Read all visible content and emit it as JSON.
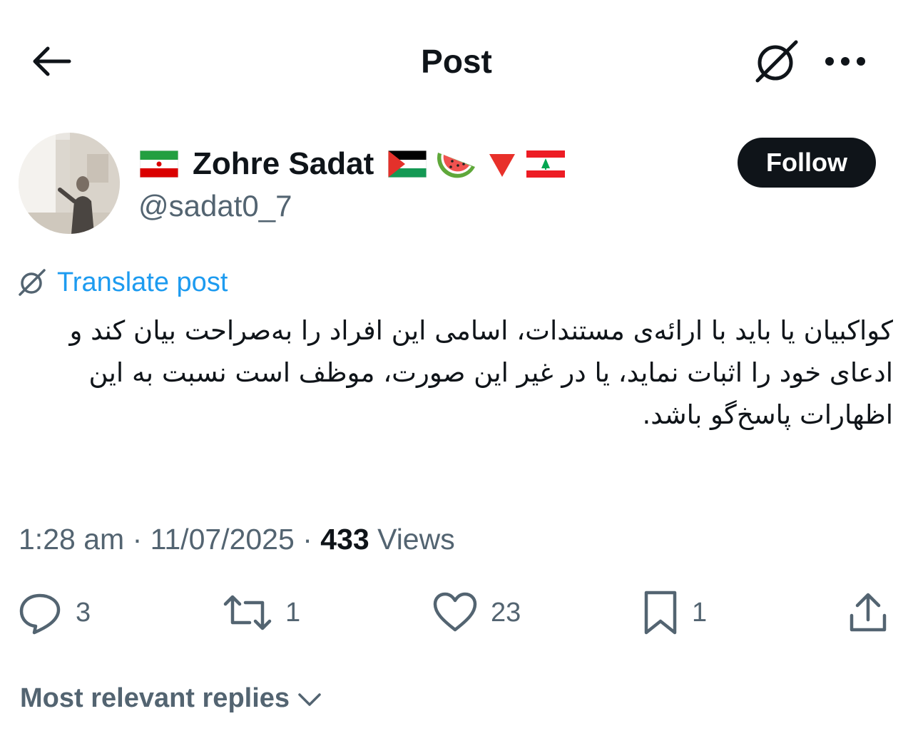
{
  "header": {
    "title": "Post"
  },
  "author": {
    "display_name": "Zohre Sadat",
    "handle": "@sadat0_7",
    "name_emojis": [
      "iran-flag",
      "palestine-flag",
      "watermelon",
      "red-triangle",
      "lebanon-flag"
    ],
    "follow_label": "Follow"
  },
  "translate": {
    "label": "Translate post"
  },
  "post": {
    "text": "کواکبیان یا باید با ارائه‌ی مستندات، اسامی این افراد را به‌صراحت بیان کند و ادعای خود را اثبات نماید، یا در غیر این صورت، موظف است نسبت به این اظهارات پاسخ‌گو باشد."
  },
  "meta": {
    "time": "1:28 am",
    "separator": "·",
    "date": "11/07/2025",
    "views_count": "433",
    "views_label": "Views"
  },
  "actions": {
    "replies": "3",
    "reposts": "1",
    "likes": "23",
    "bookmarks": "1"
  },
  "replies_sort": {
    "label": "Most relevant replies"
  },
  "colors": {
    "text": "#0f1419",
    "secondary": "#536471",
    "accent": "#1d9bf0",
    "button_bg": "#0f1419"
  }
}
